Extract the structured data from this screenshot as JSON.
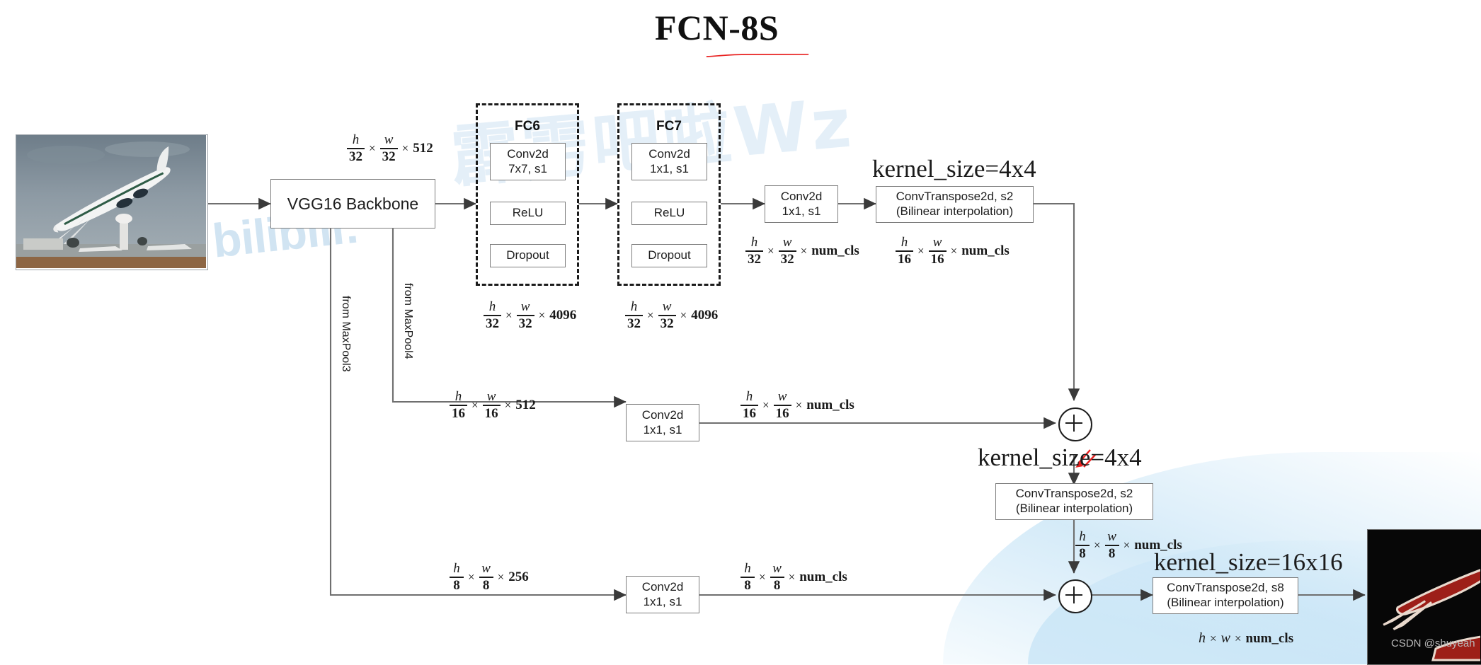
{
  "title": "FCN-8S",
  "accent_red": "#e8201f",
  "watermarks": {
    "bilibili": "bilibili:",
    "chinese": "霹雳吧啦Wz",
    "csdn": "CSDN @shuyeah"
  },
  "images": {
    "input_alt": "airplane-takeoff-photo",
    "output_alt": "airplane-segmentation-mask"
  },
  "blocks": {
    "backbone": "VGG16 Backbone",
    "fc6_title": "FC6",
    "fc7_title": "FC7",
    "fc6_conv_l1": "Conv2d",
    "fc6_conv_l2": "7x7, s1",
    "fc6_relu": "ReLU",
    "fc6_dropout": "Dropout",
    "fc7_conv_l1": "Conv2d",
    "fc7_conv_l2": "1x1, s1",
    "fc7_relu": "ReLU",
    "fc7_dropout": "Dropout",
    "score32_l1": "Conv2d",
    "score32_l2": "1x1, s1",
    "up32_l1": "ConvTranspose2d, s2",
    "up32_l2": "(Bilinear interpolation)",
    "score16_l1": "Conv2d",
    "score16_l2": "1x1, s1",
    "up16_l1": "ConvTranspose2d, s2",
    "up16_l2": "(Bilinear interpolation)",
    "score8_l1": "Conv2d",
    "score8_l2": "1x1, s1",
    "up8_l1": "ConvTranspose2d, s8",
    "up8_l2": "(Bilinear interpolation)"
  },
  "skip_labels": {
    "maxpool3": "from MaxPool3",
    "maxpool4": "from MaxPool4"
  },
  "kernel_annotations": {
    "k1": "kernel_size=4x4",
    "k2": "kernel_size=4x4",
    "k3": "kernel_size=16x16"
  },
  "tensor_shapes": {
    "backbone_out": {
      "num1": "h",
      "den1": "32",
      "num2": "w",
      "den2": "32",
      "chan": "512"
    },
    "fc6_out": {
      "num1": "h",
      "den1": "32",
      "num2": "w",
      "den2": "32",
      "chan": "4096"
    },
    "fc7_out": {
      "num1": "h",
      "den1": "32",
      "num2": "w",
      "den2": "32",
      "chan": "4096"
    },
    "score32_out": {
      "num1": "h",
      "den1": "32",
      "num2": "w",
      "den2": "32",
      "chan": "num_cls"
    },
    "up32_out": {
      "num1": "h",
      "den1": "16",
      "num2": "w",
      "den2": "16",
      "chan": "num_cls"
    },
    "pool4_in": {
      "num1": "h",
      "den1": "16",
      "num2": "w",
      "den2": "16",
      "chan": "512"
    },
    "score16_out": {
      "num1": "h",
      "den1": "16",
      "num2": "w",
      "den2": "16",
      "chan": "num_cls"
    },
    "up16_out": {
      "num1": "h",
      "den1": "8",
      "num2": "w",
      "den2": "8",
      "chan": "num_cls"
    },
    "pool3_in": {
      "num1": "h",
      "den1": "8",
      "num2": "w",
      "den2": "8",
      "chan": "256"
    },
    "score8_out": {
      "num1": "h",
      "den1": "8",
      "num2": "w",
      "den2": "8",
      "chan": "num_cls"
    },
    "final_out": {
      "num1": "h",
      "num2": "w",
      "chan": "num_cls"
    }
  },
  "sum_nodes": {
    "glyph": "+",
    "count": 2
  }
}
